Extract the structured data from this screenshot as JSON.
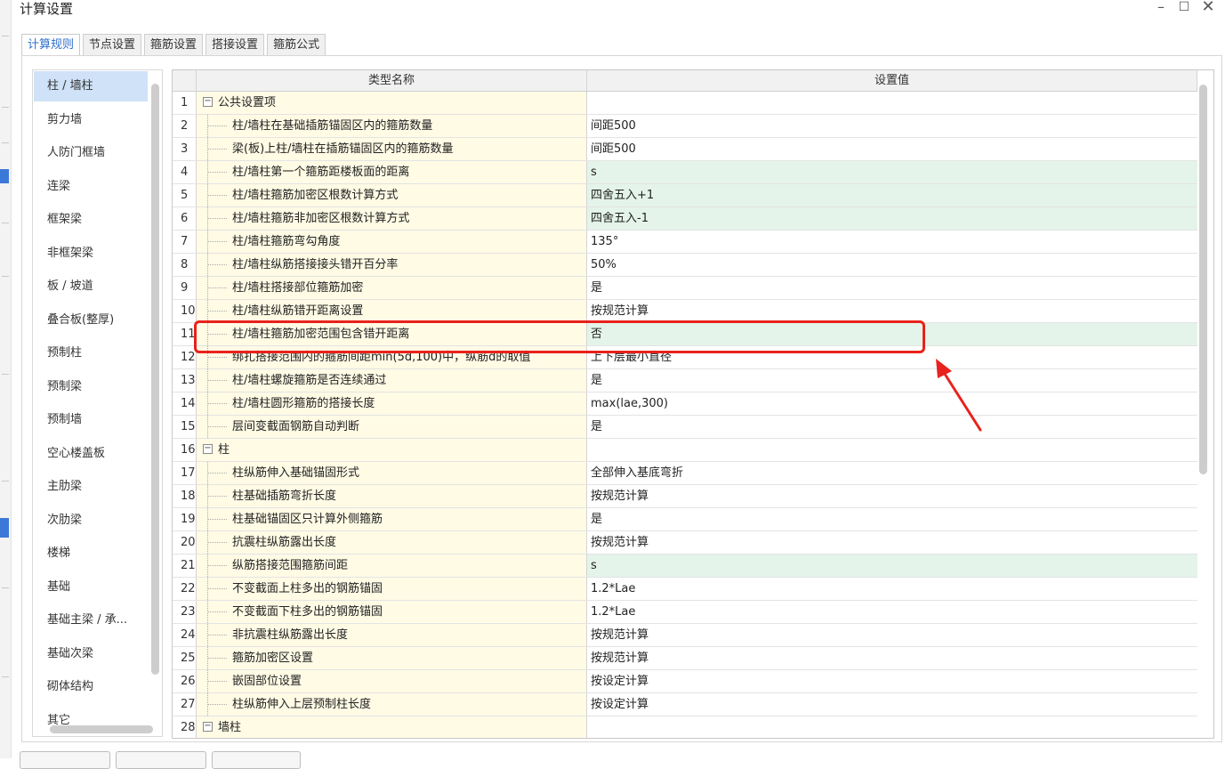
{
  "window": {
    "title": "计算设置",
    "minimize_glyph": "–",
    "maximize_glyph": "☐",
    "close_glyph": "✕"
  },
  "tabs": [
    {
      "label": "计算规则",
      "active": true
    },
    {
      "label": "节点设置",
      "active": false
    },
    {
      "label": "箍筋设置",
      "active": false
    },
    {
      "label": "搭接设置",
      "active": false
    },
    {
      "label": "箍筋公式",
      "active": false
    }
  ],
  "categories": [
    "柱 / 墙柱",
    "剪力墙",
    "人防门框墙",
    "连梁",
    "框架梁",
    "非框架梁",
    "板 / 坡道",
    "叠合板(整厚)",
    "预制柱",
    "预制梁",
    "预制墙",
    "空心楼盖板",
    "主肋梁",
    "次肋梁",
    "楼梯",
    "基础",
    "基础主梁 / 承...",
    "基础次梁",
    "砌体结构",
    "其它"
  ],
  "selected_category": "柱 / 墙柱",
  "grid": {
    "header_name": "类型名称",
    "header_value": "设置值",
    "rows": [
      {
        "num": "1",
        "name": "公共设置项",
        "value": "",
        "group": true,
        "hl": false
      },
      {
        "num": "2",
        "name": "柱/墙柱在基础插筋锚固区内的箍筋数量",
        "value": "间距500",
        "group": false,
        "hl": false
      },
      {
        "num": "3",
        "name": "梁(板)上柱/墙柱在插筋锚固区内的箍筋数量",
        "value": "间距500",
        "group": false,
        "hl": false
      },
      {
        "num": "4",
        "name": "柱/墙柱第一个箍筋距楼板面的距离",
        "value": "s",
        "group": false,
        "hl": true
      },
      {
        "num": "5",
        "name": "柱/墙柱箍筋加密区根数计算方式",
        "value": "四舍五入+1",
        "group": false,
        "hl": true
      },
      {
        "num": "6",
        "name": "柱/墙柱箍筋非加密区根数计算方式",
        "value": "四舍五入-1",
        "group": false,
        "hl": true
      },
      {
        "num": "7",
        "name": "柱/墙柱箍筋弯勾角度",
        "value": "135°",
        "group": false,
        "hl": false
      },
      {
        "num": "8",
        "name": "柱/墙柱纵筋搭接接头错开百分率",
        "value": "50%",
        "group": false,
        "hl": false
      },
      {
        "num": "9",
        "name": "柱/墙柱搭接部位箍筋加密",
        "value": "是",
        "group": false,
        "hl": false
      },
      {
        "num": "10",
        "name": "柱/墙柱纵筋错开距离设置",
        "value": "按规范计算",
        "group": false,
        "hl": false
      },
      {
        "num": "11",
        "name": "柱/墙柱箍筋加密范围包含错开距离",
        "value": "否",
        "group": false,
        "hl": true
      },
      {
        "num": "12",
        "name": "绑扎搭接范围内的箍筋间距min(5d,100)中，纵筋d的取值",
        "value": "上下层最小直径",
        "group": false,
        "hl": false
      },
      {
        "num": "13",
        "name": "柱/墙柱螺旋箍筋是否连续通过",
        "value": "是",
        "group": false,
        "hl": false
      },
      {
        "num": "14",
        "name": "柱/墙柱圆形箍筋的搭接长度",
        "value": "max(lae,300)",
        "group": false,
        "hl": false
      },
      {
        "num": "15",
        "name": "层间变截面钢筋自动判断",
        "value": "是",
        "group": false,
        "hl": false
      },
      {
        "num": "16",
        "name": "柱",
        "value": "",
        "group": true,
        "hl": false
      },
      {
        "num": "17",
        "name": "柱纵筋伸入基础锚固形式",
        "value": "全部伸入基底弯折",
        "group": false,
        "hl": false
      },
      {
        "num": "18",
        "name": "柱基础插筋弯折长度",
        "value": "按规范计算",
        "group": false,
        "hl": false
      },
      {
        "num": "19",
        "name": "柱基础锚固区只计算外侧箍筋",
        "value": "是",
        "group": false,
        "hl": false
      },
      {
        "num": "20",
        "name": "抗震柱纵筋露出长度",
        "value": "按规范计算",
        "group": false,
        "hl": false
      },
      {
        "num": "21",
        "name": "纵筋搭接范围箍筋间距",
        "value": "s",
        "group": false,
        "hl": true
      },
      {
        "num": "22",
        "name": "不变截面上柱多出的钢筋锚固",
        "value": "1.2*Lae",
        "group": false,
        "hl": false
      },
      {
        "num": "23",
        "name": "不变截面下柱多出的钢筋锚固",
        "value": "1.2*Lae",
        "group": false,
        "hl": false
      },
      {
        "num": "24",
        "name": "非抗震柱纵筋露出长度",
        "value": "按规范计算",
        "group": false,
        "hl": false
      },
      {
        "num": "25",
        "name": "箍筋加密区设置",
        "value": "按规范计算",
        "group": false,
        "hl": false
      },
      {
        "num": "26",
        "name": "嵌固部位设置",
        "value": "按设定计算",
        "group": false,
        "hl": false
      },
      {
        "num": "27",
        "name": "柱纵筋伸入上层预制柱长度",
        "value": "按设定计算",
        "group": false,
        "hl": false
      },
      {
        "num": "28",
        "name": "墙柱",
        "value": "",
        "group": true,
        "hl": false
      }
    ]
  },
  "annotation": {
    "highlighted_row": "11",
    "color": "#e8221c"
  },
  "colors": {
    "accent": "#2f6fc9",
    "name_cell_bg": "#fffbe5",
    "value_highlight_bg": "#e4f4ea",
    "selected_bg": "#cfe2f7"
  }
}
